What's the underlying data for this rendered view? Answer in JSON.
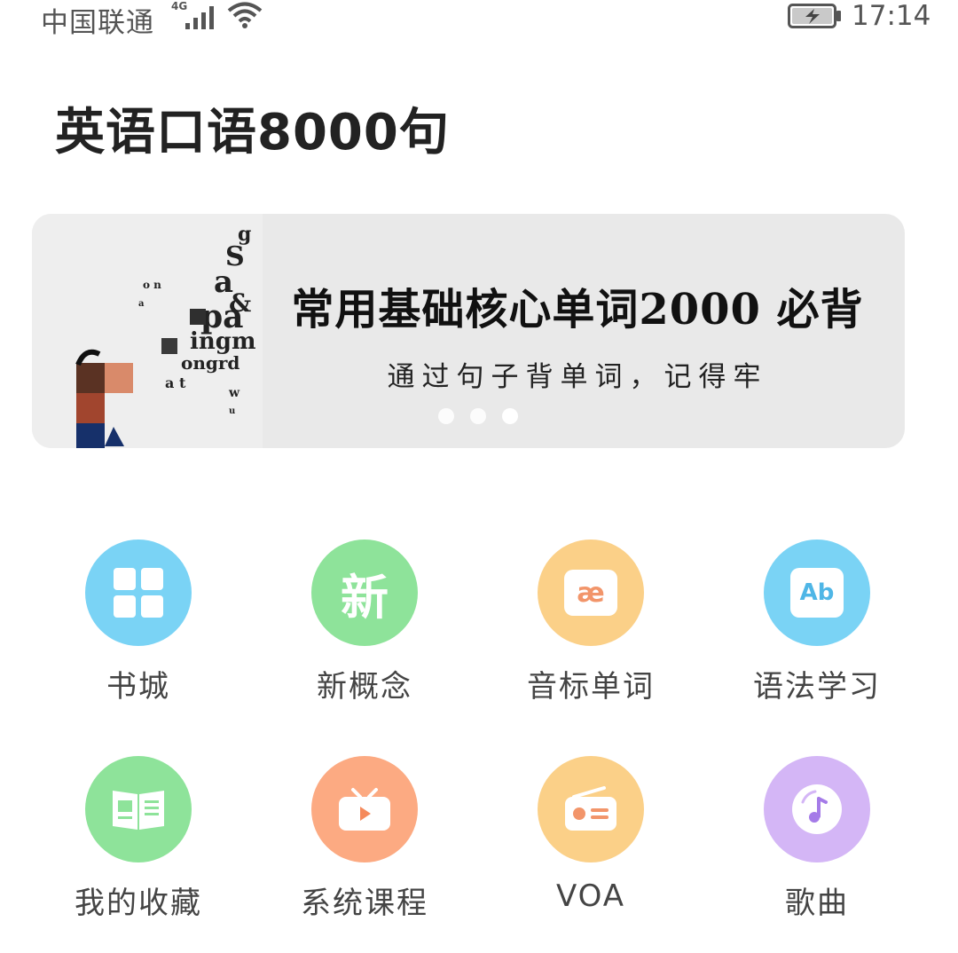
{
  "status_bar": {
    "carrier": "中国联通",
    "network": "4G",
    "time": "17:14"
  },
  "app": {
    "title": "英语口语8000句"
  },
  "banner": {
    "headline": "常用基础核心单词2000 必背",
    "subline": "通过句子背单词，记得牢",
    "page_count": 3,
    "active_page_index": 2
  },
  "menu": {
    "items": [
      {
        "label": "书城",
        "icon": "grid-icon",
        "color": "#7ad3f5"
      },
      {
        "label": "新概念",
        "icon": "xin-character-icon",
        "color": "#8ee39a",
        "icon_text": "新"
      },
      {
        "label": "音标单词",
        "icon": "phonetic-card-icon",
        "color": "#fbd088",
        "icon_text": "æ"
      },
      {
        "label": "语法学习",
        "icon": "ab-card-icon",
        "color": "#7ad3f5",
        "icon_text": "Ab"
      },
      {
        "label": "我的收藏",
        "icon": "open-book-icon",
        "color": "#8ee39a"
      },
      {
        "label": "系统课程",
        "icon": "tv-play-icon",
        "color": "#fcaa82"
      },
      {
        "label": "VOA",
        "icon": "radio-icon",
        "color": "#fbd088"
      },
      {
        "label": "歌曲",
        "icon": "music-disc-icon",
        "color": "#d4b6f6"
      }
    ]
  }
}
